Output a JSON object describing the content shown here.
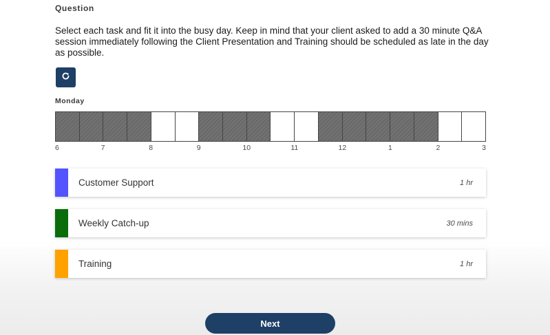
{
  "question": {
    "label": "Question",
    "text": "Select each task and fit it into the busy day. Keep in mind that your client asked to add a 30 minute Q&A session immediately following the Client Presentation and Training should be scheduled as late in the day as possible."
  },
  "reset_button": {
    "icon": "refresh-icon"
  },
  "schedule": {
    "day": "Monday",
    "hour_labels": [
      "6",
      "7",
      "8",
      "9",
      "10",
      "11",
      "12",
      "1",
      "2",
      "3"
    ],
    "slots_busy": [
      true,
      true,
      true,
      true,
      false,
      false,
      true,
      true,
      true,
      false,
      false,
      true,
      true,
      true,
      true,
      true,
      false,
      false
    ],
    "colors": {
      "busy": "#6d6d6d",
      "free": "#ffffff"
    }
  },
  "tasks": [
    {
      "name": "Customer Support",
      "duration": "1 hr",
      "color": "#5353ff"
    },
    {
      "name": "Weekly Catch-up",
      "duration": "30 mins",
      "color": "#0a6d0a"
    },
    {
      "name": "Training",
      "duration": "1 hr",
      "color": "#ffa200"
    }
  ],
  "next_button": {
    "label": "Next"
  },
  "colors": {
    "accent": "#1e3f66"
  }
}
